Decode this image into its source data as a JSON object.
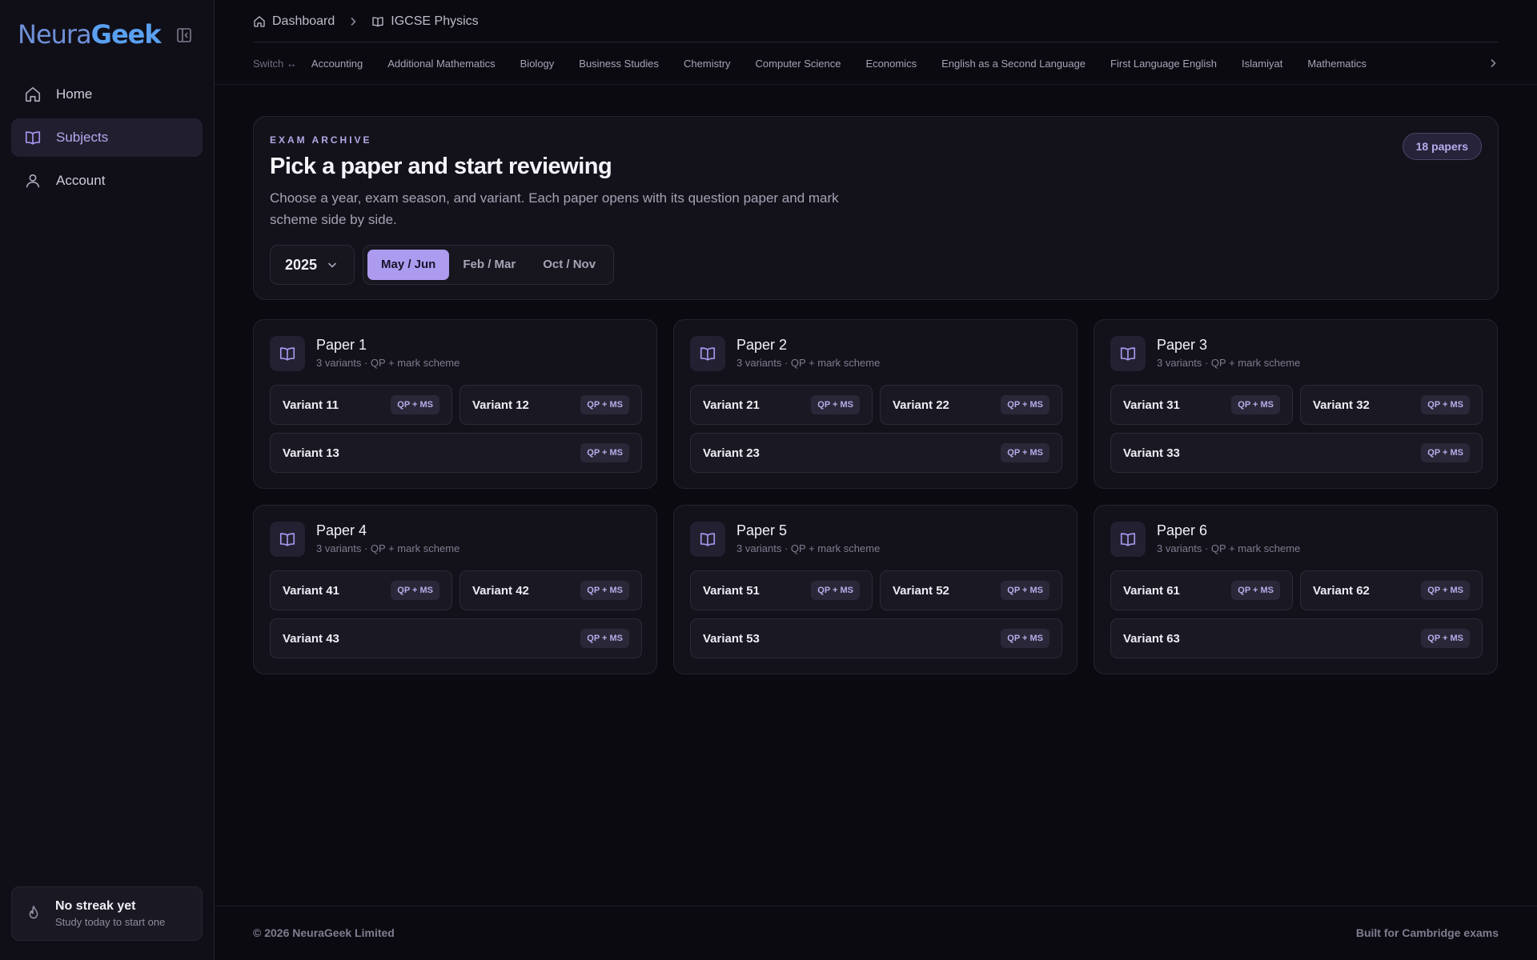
{
  "brand": {
    "part1": "Neura",
    "part2": "Geek"
  },
  "sidebar": {
    "items": [
      {
        "label": "Home",
        "icon": "home-icon",
        "active": false
      },
      {
        "label": "Subjects",
        "icon": "book-icon",
        "active": true
      },
      {
        "label": "Account",
        "icon": "user-icon",
        "active": false
      }
    ],
    "streak": {
      "title": "No streak yet",
      "subtitle": "Study today to start one",
      "icon": "flame-icon"
    }
  },
  "breadcrumb": {
    "home": "Dashboard",
    "current": "IGCSE Physics"
  },
  "subject_bar": {
    "switch_label": "Switch ↔",
    "subjects": [
      "Accounting",
      "Additional Mathematics",
      "Biology",
      "Business Studies",
      "Chemistry",
      "Computer Science",
      "Economics",
      "English as a Second Language",
      "First Language English",
      "Islamiyat",
      "Mathematics"
    ]
  },
  "hero": {
    "kicker": "EXAM ARCHIVE",
    "title": "Pick a paper and start reviewing",
    "description": "Choose a year, exam season, and variant. Each paper opens with its question paper and mark scheme side by side.",
    "badge": "18 papers",
    "year": "2025",
    "seasons": [
      {
        "label": "May / Jun",
        "selected": true
      },
      {
        "label": "Feb / Mar",
        "selected": false
      },
      {
        "label": "Oct / Nov",
        "selected": false
      }
    ]
  },
  "papers": [
    {
      "title": "Paper 1",
      "subtitle": "3 variants · QP + mark scheme",
      "variants": [
        {
          "label": "Variant 11",
          "tag": "QP + MS"
        },
        {
          "label": "Variant 12",
          "tag": "QP + MS"
        },
        {
          "label": "Variant 13",
          "tag": "QP + MS"
        }
      ]
    },
    {
      "title": "Paper 2",
      "subtitle": "3 variants · QP + mark scheme",
      "variants": [
        {
          "label": "Variant 21",
          "tag": "QP + MS"
        },
        {
          "label": "Variant 22",
          "tag": "QP + MS"
        },
        {
          "label": "Variant 23",
          "tag": "QP + MS"
        }
      ]
    },
    {
      "title": "Paper 3",
      "subtitle": "3 variants · QP + mark scheme",
      "variants": [
        {
          "label": "Variant 31",
          "tag": "QP + MS"
        },
        {
          "label": "Variant 32",
          "tag": "QP + MS"
        },
        {
          "label": "Variant 33",
          "tag": "QP + MS"
        }
      ]
    },
    {
      "title": "Paper 4",
      "subtitle": "3 variants · QP + mark scheme",
      "variants": [
        {
          "label": "Variant 41",
          "tag": "QP + MS"
        },
        {
          "label": "Variant 42",
          "tag": "QP + MS"
        },
        {
          "label": "Variant 43",
          "tag": "QP + MS"
        }
      ]
    },
    {
      "title": "Paper 5",
      "subtitle": "3 variants · QP + mark scheme",
      "variants": [
        {
          "label": "Variant 51",
          "tag": "QP + MS"
        },
        {
          "label": "Variant 52",
          "tag": "QP + MS"
        },
        {
          "label": "Variant 53",
          "tag": "QP + MS"
        }
      ]
    },
    {
      "title": "Paper 6",
      "subtitle": "3 variants · QP + mark scheme",
      "variants": [
        {
          "label": "Variant 61",
          "tag": "QP + MS"
        },
        {
          "label": "Variant 62",
          "tag": "QP + MS"
        },
        {
          "label": "Variant 63",
          "tag": "QP + MS"
        }
      ]
    }
  ],
  "footer": {
    "copyright": "© 2026 NeuraGeek Limited",
    "tagline": "Built for Cambridge exams"
  },
  "colors": {
    "accent": "#ad9bf0",
    "background": "#0b0a11",
    "surface": "#13121b",
    "brand_blue": "#5aa0f0"
  }
}
